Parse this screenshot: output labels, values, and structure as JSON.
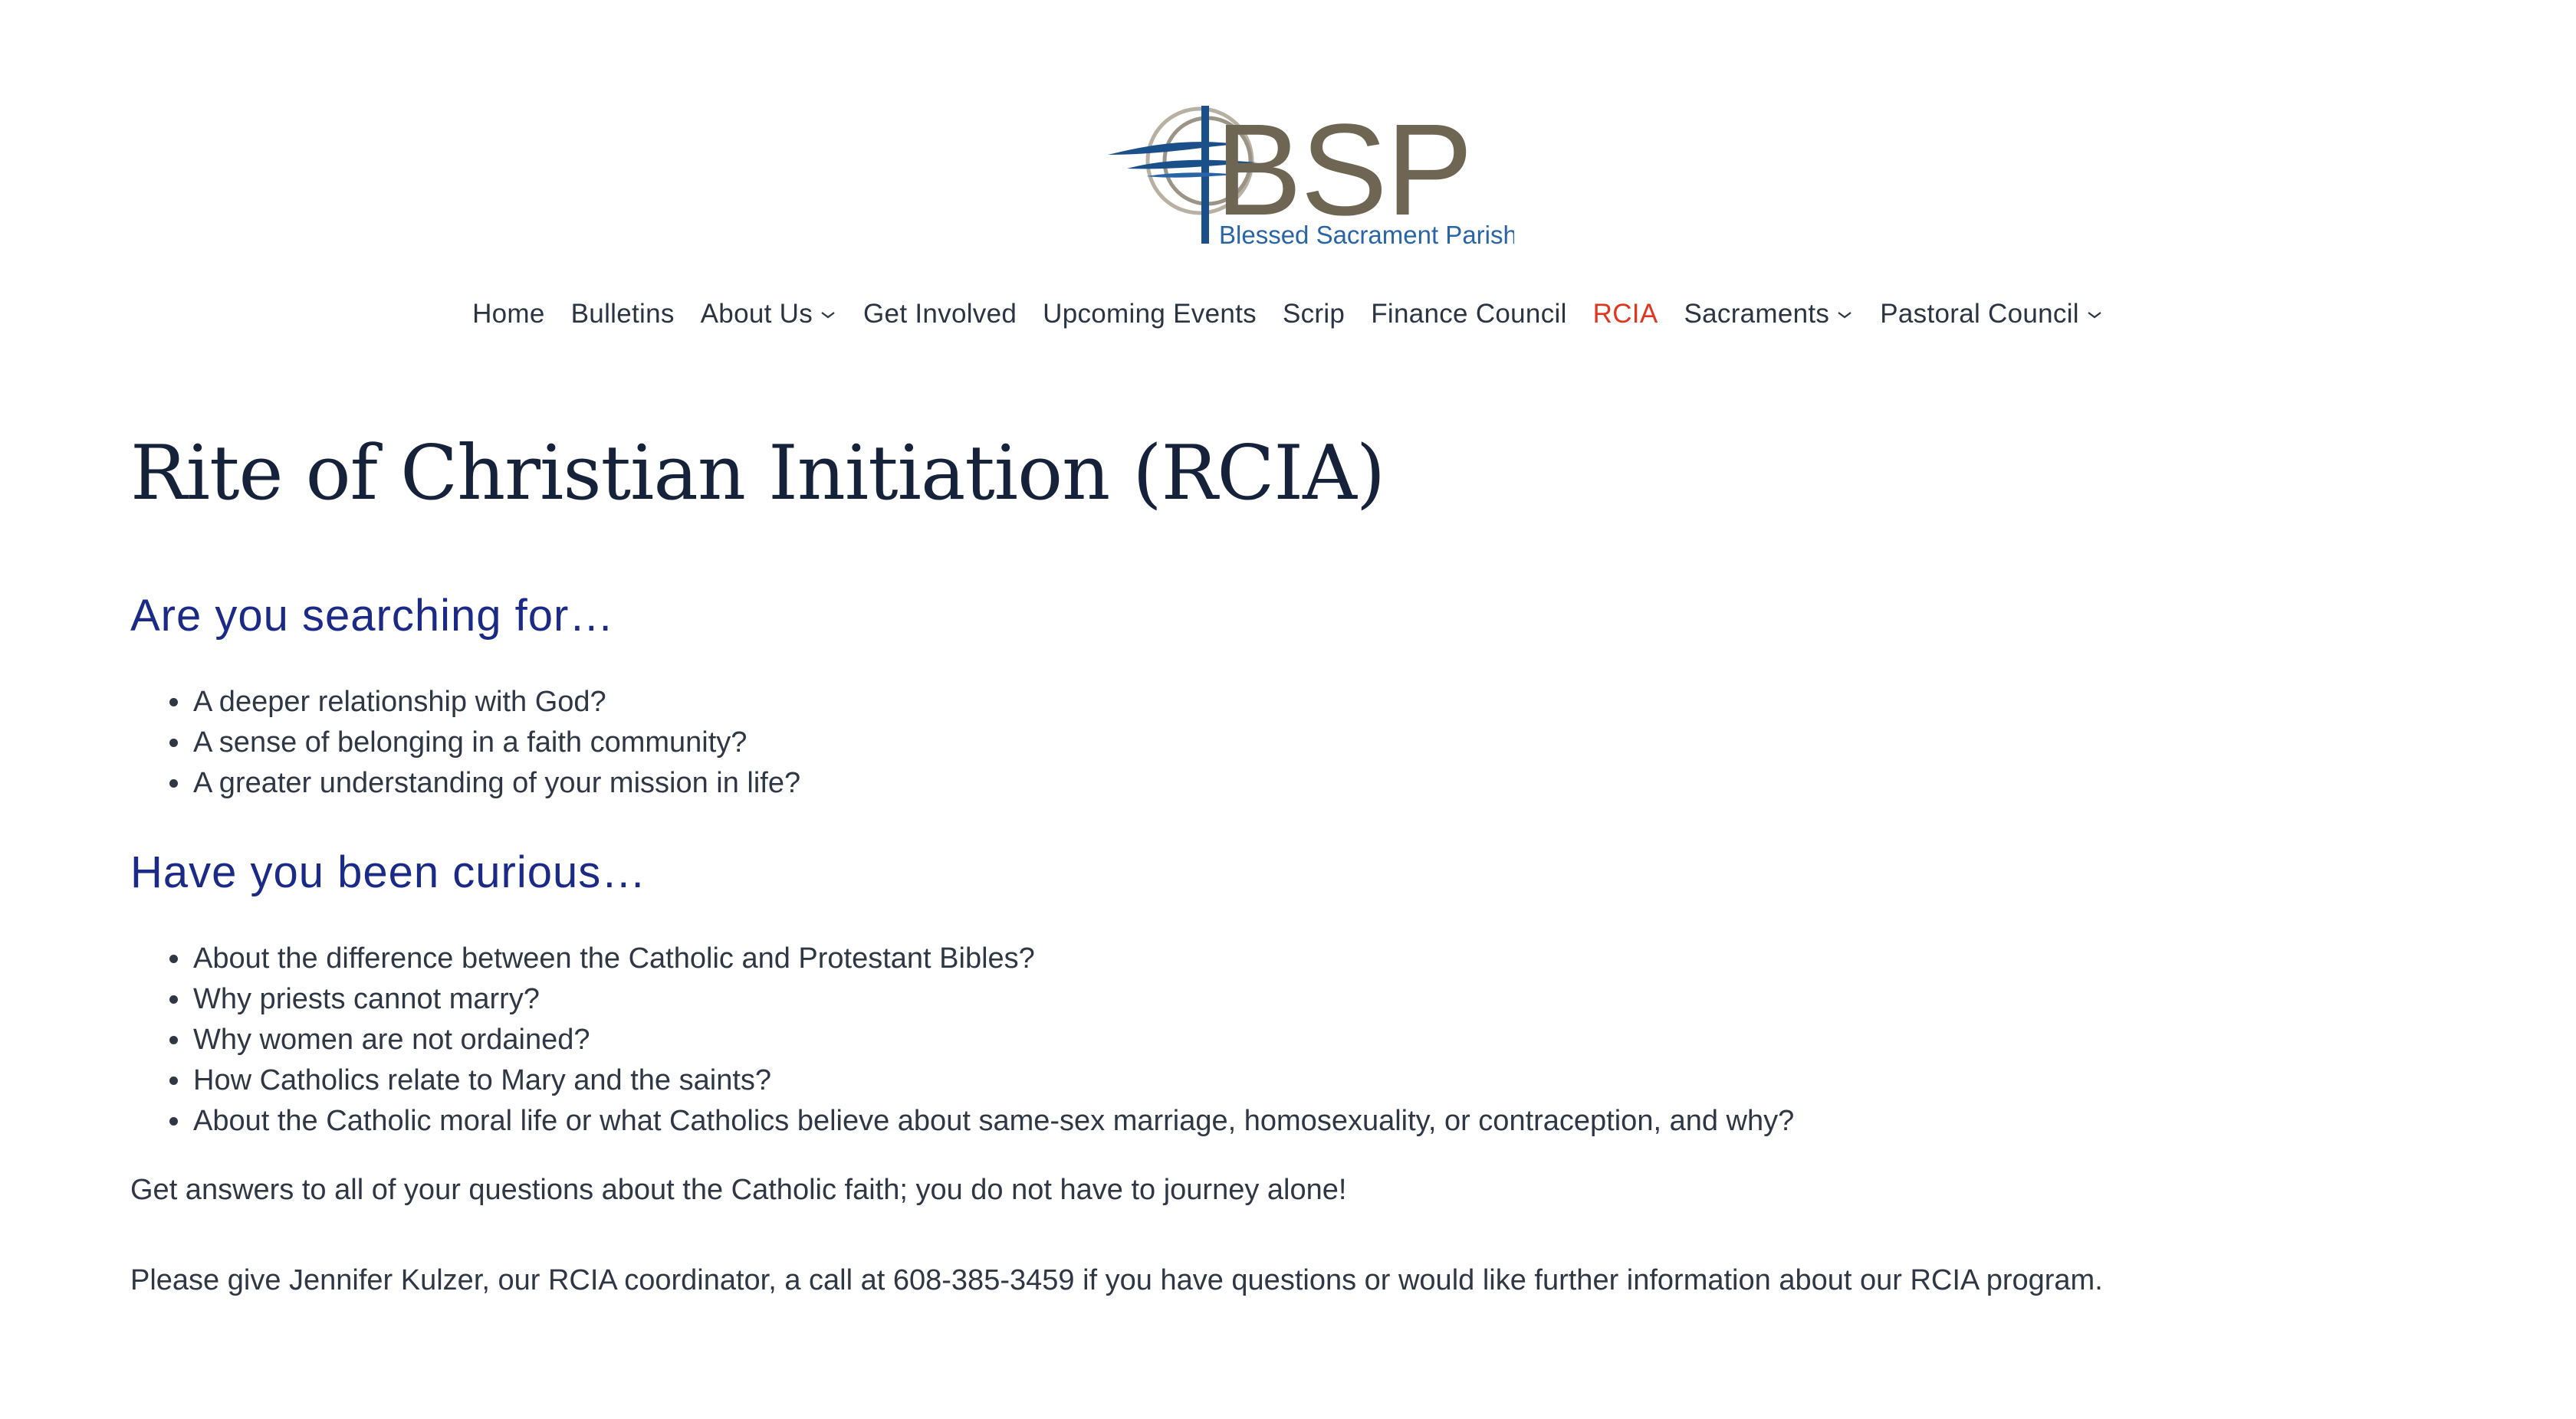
{
  "logo": {
    "letters": "BSP",
    "tagline": "Blessed Sacrament Parish",
    "colors": {
      "letters": "#6e6553",
      "cross": "#1a4f8a",
      "tagline": "#2a64a8",
      "ring": "#9b9385"
    }
  },
  "nav": {
    "items": [
      {
        "label": "Home"
      },
      {
        "label": "Bulletins"
      },
      {
        "label": "About Us",
        "dropdown": true
      },
      {
        "label": "Get Involved"
      },
      {
        "label": "Upcoming Events"
      },
      {
        "label": "Scrip"
      },
      {
        "label": "Finance Council"
      },
      {
        "label": "RCIA",
        "active": true
      },
      {
        "label": "Sacraments",
        "dropdown": true
      },
      {
        "label": "Pastoral Council",
        "dropdown": true
      }
    ],
    "active_color": "#e0361f"
  },
  "page": {
    "title": "Rite of Christian Initiation (RCIA)",
    "section1": {
      "heading": "Are you searching for…",
      "items": [
        "A deeper relationship with God?",
        "A sense of belonging in a faith community?",
        "A greater understanding of your mission in life?"
      ]
    },
    "section2": {
      "heading": "Have you been curious…",
      "items": [
        "About the difference between the Catholic and Protestant Bibles?",
        "Why priests cannot marry?",
        "Why women are not ordained?",
        "How Catholics relate to Mary and the saints?",
        "About the Catholic moral life or what Catholics believe about same-sex marriage, homosexuality, or contraception, and why?"
      ]
    },
    "paragraph1": "Get answers to all of your questions about the Catholic faith; you do not have to journey alone!",
    "paragraph2": "Please give Jennifer Kulzer, our RCIA coordinator, a call at 608-385-3459 if you have questions or would like further information about our RCIA program."
  },
  "colors": {
    "heading": "#1b2a86",
    "title": "#16213a",
    "body_text": "#2f3744"
  }
}
